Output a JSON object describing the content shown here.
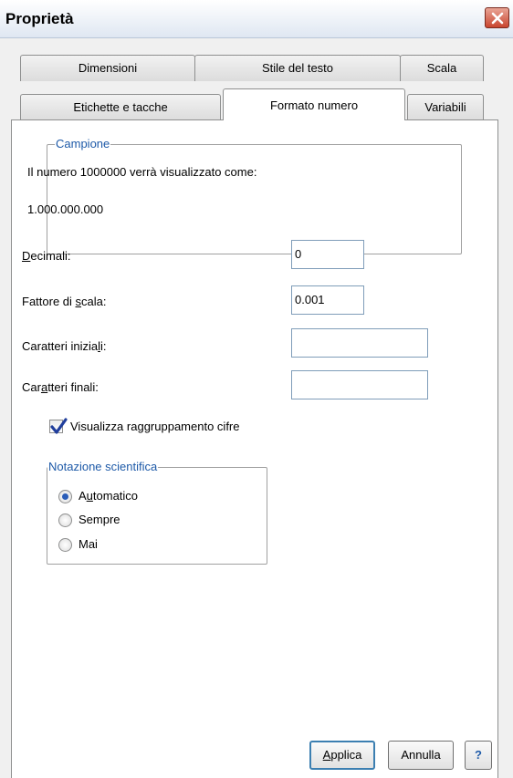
{
  "window": {
    "title": "Proprietà"
  },
  "tabs": {
    "row1": [
      {
        "label": "Dimensioni"
      },
      {
        "label": "Stile del testo"
      },
      {
        "label": "Scala"
      }
    ],
    "row2": [
      {
        "label": "Etichette e tacche"
      },
      {
        "label": "Formato numero"
      },
      {
        "label": "Variabili"
      }
    ],
    "active": "Formato numero"
  },
  "sample": {
    "legend": "Campione",
    "description": "Il numero 1000000 verrà visualizzato come:",
    "result": "1.000.000.000"
  },
  "fields": {
    "decimals": {
      "label_pre": "",
      "label_u": "D",
      "label_post": "ecimali:",
      "value": "0"
    },
    "scale": {
      "label_pre": "Fattore di ",
      "label_u": "s",
      "label_post": "cala:",
      "value": "0.001"
    },
    "leading": {
      "label_pre": "Caratteri inizia",
      "label_u": "l",
      "label_post": "i:",
      "value": ""
    },
    "trailing": {
      "label_pre": "Car",
      "label_u": "a",
      "label_post": "tteri finali:",
      "value": ""
    }
  },
  "grouping": {
    "label_pre": "Visualizza ra",
    "label_u": "g",
    "label_post": "gruppamento cifre",
    "checked": true
  },
  "scientific": {
    "legend": "Notazione scientifica",
    "options": [
      {
        "label_pre": "A",
        "label_u": "u",
        "label_post": "tomatico",
        "selected": true
      },
      {
        "label_pre": "",
        "label_u": "",
        "label_post": "Sempre",
        "selected": false
      },
      {
        "label_pre": "",
        "label_u": "",
        "label_post": "Mai",
        "selected": false
      }
    ]
  },
  "buttons": {
    "apply": {
      "label_pre": "",
      "label_u": "A",
      "label_post": "pplica"
    },
    "cancel": {
      "label": "Annulla"
    },
    "help": {
      "label": "?"
    }
  },
  "colors": {
    "accent": "#1e5aa8",
    "close": "#c9452f"
  }
}
